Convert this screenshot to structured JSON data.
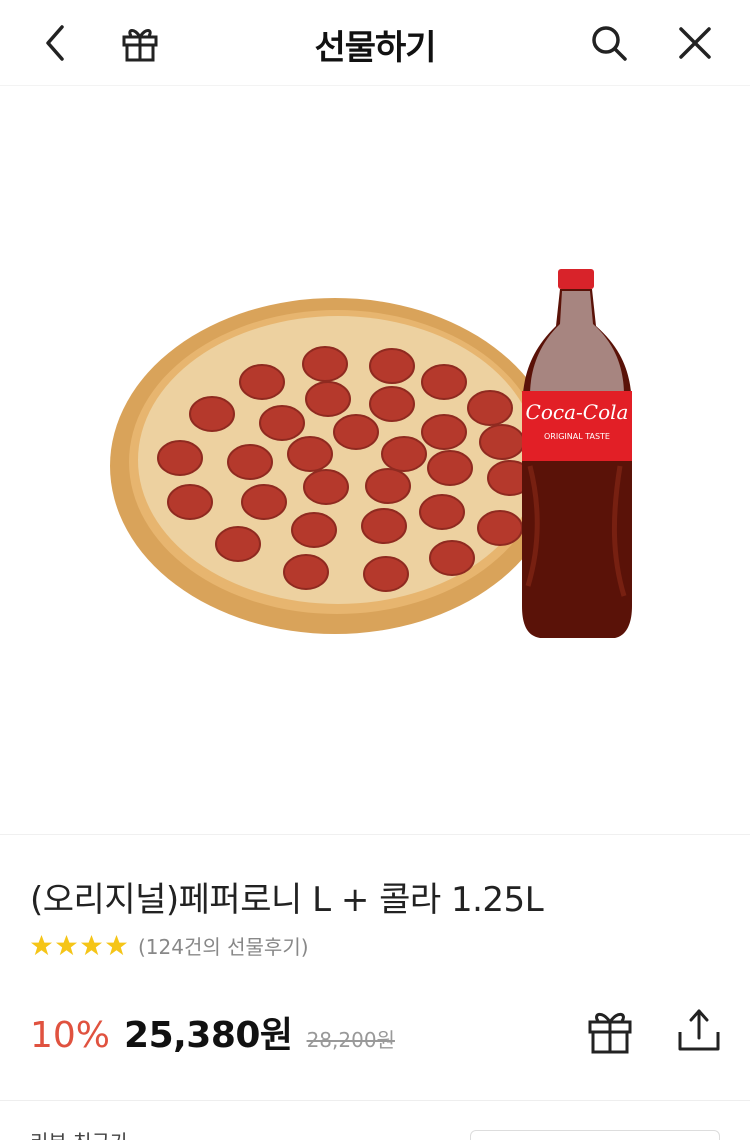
{
  "header": {
    "title": "선물하기",
    "icons": {
      "back": "chevron-left-icon",
      "gift": "gift-icon",
      "search": "search-icon",
      "close": "close-icon"
    }
  },
  "product": {
    "image_alt": "pepperoni-pizza-and-coca-cola",
    "bottle_label": "Coca-Cola",
    "bottle_sublabel": "ORIGINAL TASTE",
    "name": "(오리지널)페퍼로니 L + 콜라 1.25L",
    "rating_stars": 4,
    "review_count_text": "(124건의 선물후기)",
    "discount": "10%",
    "price": "25,380원",
    "original_price": "28,200원"
  },
  "footer": {
    "text": "리뷰 친구가 ..."
  },
  "colors": {
    "discount": "#e0523f",
    "star": "#f5c518",
    "text": "#222222"
  }
}
